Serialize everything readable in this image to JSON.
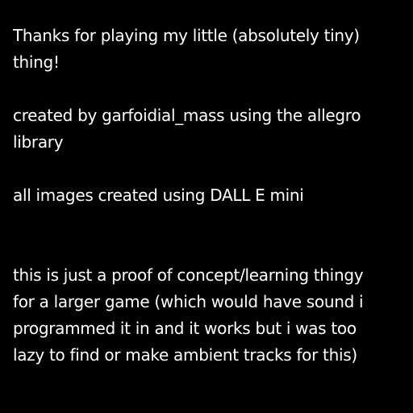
{
  "credits": {
    "thanks": [
      "Thanks for playing my little (absolutely tiny)",
      "thing!"
    ],
    "created_by": [
      "created by garfoidial_mass using the allegro",
      "library"
    ],
    "images": "all images created using DALL E mini",
    "note": [
      "this is just a proof of concept/learning thingy",
      "for a larger game (which would have sound i",
      "programmed it in and it works but i was too",
      "lazy to find or make ambient tracks for this)"
    ]
  },
  "colors": {
    "background": "#000000",
    "text": "#ffffff"
  }
}
